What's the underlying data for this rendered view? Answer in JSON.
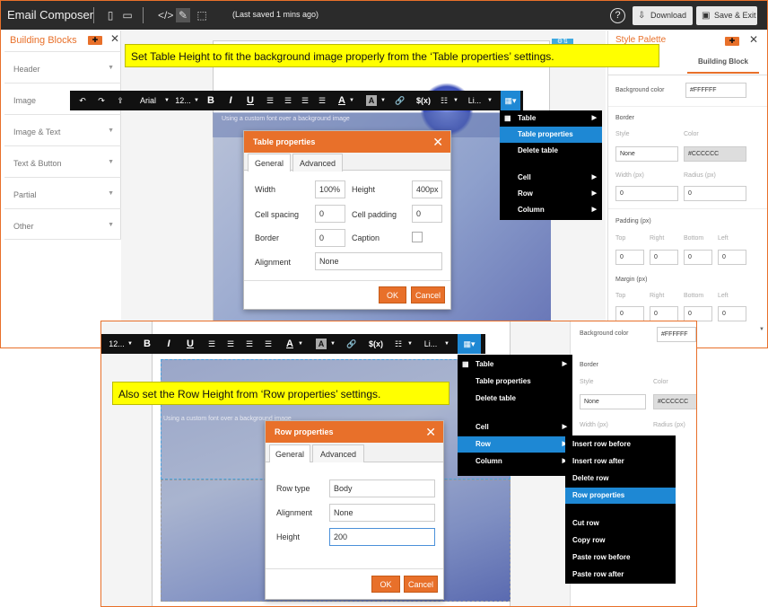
{
  "app": {
    "title": "Email Composer",
    "saved_status": "(Last saved 1 mins ago)",
    "help_label": "?",
    "download_label": "Download",
    "save_exit_label": "Save & Exit"
  },
  "left_panel": {
    "title": "Building Blocks",
    "items": [
      "Header",
      "Image",
      "Image & Text",
      "Text & Button",
      "Partial",
      "Other"
    ]
  },
  "callouts": {
    "top": "Set Table Height to fit the background image properly from the ‘Table properties’ settings.",
    "bottom": "Also set the Row Height from ‘Row properties’ settings."
  },
  "toolbar": {
    "font": "Arial",
    "size": "12...",
    "bold": "B",
    "italic": "I",
    "underline": "U",
    "font_color": "A",
    "bg_color": "A",
    "merge_tag": "$(x)",
    "line_height": "Li..."
  },
  "canvas_text": "Using a custom font over a background image",
  "table_dialog": {
    "title": "Table properties",
    "tabs": [
      "General",
      "Advanced"
    ],
    "width_label": "Width",
    "width_value": "100%",
    "height_label": "Height",
    "height_value": "400px",
    "cell_spacing_label": "Cell spacing",
    "cell_spacing_value": "0",
    "cell_padding_label": "Cell padding",
    "cell_padding_value": "0",
    "border_label": "Border",
    "border_value": "0",
    "caption_label": "Caption",
    "alignment_label": "Alignment",
    "alignment_value": "None",
    "ok": "OK",
    "cancel": "Cancel"
  },
  "table_menu_top": [
    "Table",
    "Table properties",
    "Delete table",
    "Cell",
    "Row",
    "Column"
  ],
  "table_menu_bottom": [
    "Table",
    "Table properties",
    "Delete table",
    "Cell",
    "Row",
    "Column"
  ],
  "row_submenu": [
    "Insert row before",
    "Insert row after",
    "Delete row",
    "Row properties",
    "Cut row",
    "Copy row",
    "Paste row before",
    "Paste row after"
  ],
  "row_dialog": {
    "title": "Row properties",
    "tabs": [
      "General",
      "Advanced"
    ],
    "row_type_label": "Row type",
    "row_type_value": "Body",
    "alignment_label": "Alignment",
    "alignment_value": "None",
    "height_label": "Height",
    "height_value": "200",
    "ok": "OK",
    "cancel": "Cancel"
  },
  "right_panel": {
    "title": "Style Palette",
    "tab": "Building Block",
    "bg_color_label": "Background color",
    "bg_color_value": "#FFFFFF",
    "border_label": "Border",
    "style_label": "Style",
    "color_label": "Color",
    "style_value": "None",
    "border_color_value": "#CCCCCC",
    "width_label": "Width (px)",
    "radius_label": "Radius (px)",
    "zero": "0",
    "padding_label": "Padding (px)",
    "margin_label": "Margin (px)",
    "top": "Top",
    "right": "Right",
    "bottom": "Bottom",
    "left": "Left"
  },
  "colors": {
    "accent": "#e8702a",
    "highlight": "#1e88d4",
    "callout": "#ffff00"
  }
}
